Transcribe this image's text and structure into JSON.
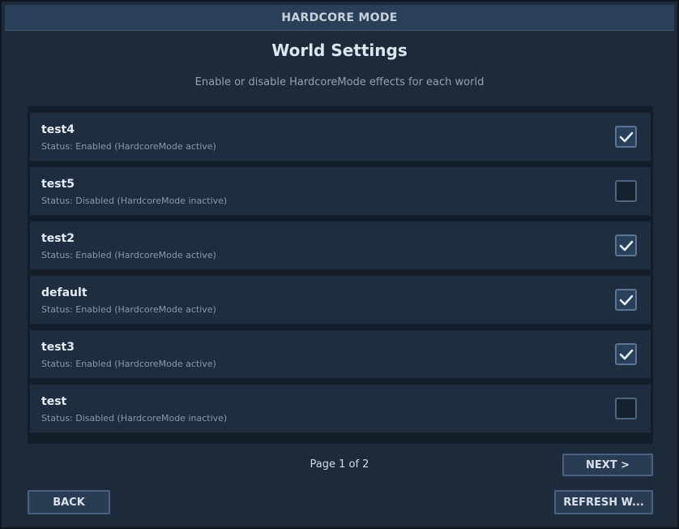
{
  "window": {
    "title": "HARDCORE MODE"
  },
  "header": {
    "title": "World Settings",
    "subtitle": "Enable or disable HardcoreMode effects for each world"
  },
  "worlds": [
    {
      "name": "test4",
      "status": "Status: Enabled (HardcoreMode active)",
      "enabled": true
    },
    {
      "name": "test5",
      "status": "Status: Disabled (HardcoreMode inactive)",
      "enabled": false
    },
    {
      "name": "test2",
      "status": "Status: Enabled (HardcoreMode active)",
      "enabled": true
    },
    {
      "name": "default",
      "status": "Status: Enabled (HardcoreMode active)",
      "enabled": true
    },
    {
      "name": "test3",
      "status": "Status: Enabled (HardcoreMode active)",
      "enabled": true
    },
    {
      "name": "test",
      "status": "Status: Disabled (HardcoreMode inactive)",
      "enabled": false
    }
  ],
  "pagination": {
    "label": "Page 1 of 2",
    "next_label": "NEXT >"
  },
  "footer": {
    "back_label": "BACK",
    "refresh_label": "REFRESH W..."
  },
  "icons": {
    "checkbox_check": "checkmark-icon"
  },
  "colors": {
    "background": "#1c2a3a",
    "titlebar": "#2a3f58",
    "row": "#1e2d40",
    "button": "#2a3c53",
    "button_border": "#4a6282"
  }
}
